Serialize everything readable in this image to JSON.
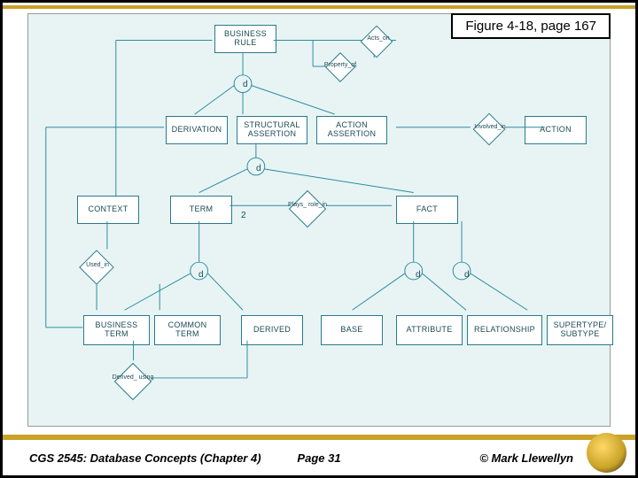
{
  "figure_label": "Figure 4-18, page 167",
  "entities": {
    "business_rule": "BUSINESS RULE",
    "derivation": "DERIVATION",
    "structural_assertion": "STRUCTURAL ASSERTION",
    "action_assertion": "ACTION ASSERTION",
    "action": "ACTION",
    "context": "CONTEXT",
    "term": "TERM",
    "fact": "FACT",
    "business_term": "BUSINESS TERM",
    "common_term": "COMMON TERM",
    "derived": "DERIVED",
    "base": "BASE",
    "attribute": "ATTRIBUTE",
    "relationship": "RELATIONSHIP",
    "supertype_subtype": "SUPERTYPE/ SUBTYPE"
  },
  "relationships": {
    "acts_on": "Acts_on",
    "property_of": "Property_of",
    "involved_in": "Involved_in",
    "plays_role_in": "Plays_ role_in",
    "used_in": "Used_in",
    "derived_using": "Derived_ using"
  },
  "labels": {
    "d": "d",
    "two": "2"
  },
  "footer": {
    "left": "CGS 2545: Database Concepts  (Chapter 4)",
    "center": "Page 31",
    "right": "© Mark Llewellyn"
  }
}
